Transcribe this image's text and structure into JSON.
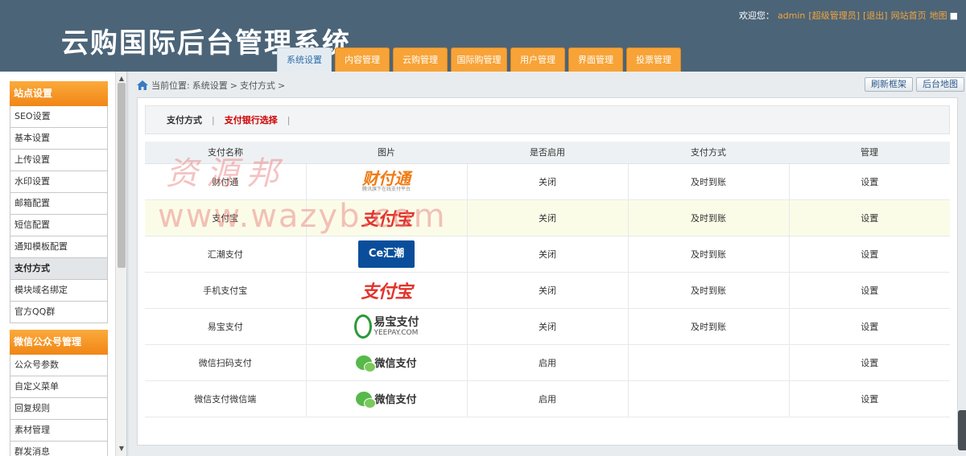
{
  "header": {
    "title": "云购国际后台管理系统",
    "welcome": "欢迎您：",
    "user": "admin",
    "role": "[超级管理员]",
    "logout": "[退出]",
    "site_home": "网站首页",
    "sitemap": "地图"
  },
  "nav": {
    "tabs": [
      {
        "label": "系统设置",
        "active": true
      },
      {
        "label": "内容管理"
      },
      {
        "label": "云购管理"
      },
      {
        "label": "国际购管理"
      },
      {
        "label": "用户管理"
      },
      {
        "label": "界面管理"
      },
      {
        "label": "投票管理"
      }
    ]
  },
  "sidebar": {
    "groups": [
      {
        "title": "站点设置",
        "items": [
          "SEO设置",
          "基本设置",
          "上传设置",
          "水印设置",
          "邮箱配置",
          "短信配置",
          "通知模板配置",
          "支付方式",
          "模块域名绑定",
          "官方QQ群"
        ]
      },
      {
        "title": "微信公众号管理",
        "items": [
          "公众号参数",
          "自定义菜单",
          "回复规则",
          "素材管理",
          "群发消息"
        ]
      }
    ]
  },
  "breadcrumb": {
    "prefix": "当前位置:",
    "level1": "系统设置",
    "level2": "支付方式",
    "sep": ">"
  },
  "toolbar": {
    "refresh": "刷新框架",
    "admin_map": "后台地图"
  },
  "subtabs": {
    "tab1": "支付方式",
    "tab2": "支付银行选择",
    "sep": "|"
  },
  "table": {
    "headers": [
      "支付名称",
      "图片",
      "是否启用",
      "支付方式",
      "管理"
    ],
    "rows": [
      {
        "name": "财付通",
        "logo": "财付通",
        "logo_sub": "腾讯旗下在线支付平台",
        "status": "关闭",
        "mode": "及时到账",
        "action": "设置"
      },
      {
        "name": "支付宝",
        "logo": "支付宝",
        "status": "关闭",
        "mode": "及时到账",
        "action": "设置"
      },
      {
        "name": "汇潮支付",
        "logo": "汇潮",
        "status": "关闭",
        "mode": "及时到账",
        "action": "设置"
      },
      {
        "name": "手机支付宝",
        "logo": "支付宝",
        "status": "关闭",
        "mode": "及时到账",
        "action": "设置"
      },
      {
        "name": "易宝支付",
        "logo": "易宝支付",
        "logo_sub": "YEEPAY.COM",
        "status": "关闭",
        "mode": "及时到账",
        "action": "设置"
      },
      {
        "name": "微信扫码支付",
        "logo": "微信支付",
        "status": "启用",
        "mode": "",
        "action": "设置"
      },
      {
        "name": "微信支付微信端",
        "logo": "微信支付",
        "status": "启用",
        "mode": "",
        "action": "设置"
      }
    ]
  },
  "watermark": {
    "line1": "资源邦",
    "line2": "www.wazyb.com"
  },
  "colors": {
    "header_bg": "#4c6478",
    "nav_tab": "#f7a337",
    "status_off": "#e00000",
    "status_on": "#1a9a1a"
  }
}
